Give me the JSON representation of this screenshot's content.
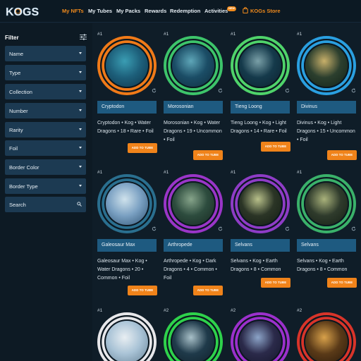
{
  "brand": {
    "logo_text": "KOGS"
  },
  "nav": {
    "my_nfts": "My NFTs",
    "my_tubes": "My Tubes",
    "my_packs": "My Packs",
    "rewards": "Rewards",
    "redemption": "Redemption",
    "activities": "Activities",
    "activities_badge": "NEW",
    "store": "KOGs Store"
  },
  "sidebar": {
    "title": "Filter",
    "filters": [
      {
        "label": "Name"
      },
      {
        "label": "Type"
      },
      {
        "label": "Collection"
      },
      {
        "label": "Number"
      },
      {
        "label": "Rarity"
      },
      {
        "label": "Foil"
      },
      {
        "label": "Border Color"
      },
      {
        "label": "Border Type"
      }
    ],
    "search_placeholder": "Search"
  },
  "cards": [
    {
      "number": "#1",
      "name": "Cryptodon",
      "desc": "Cryptodon • Kog • Water Dragons • 18 • Rare • Foil",
      "button": "ADD TO TUBE",
      "ring": "#f07a18"
    },
    {
      "number": "#1",
      "name": "Morosonian",
      "desc": "Morosonian • Kog • Water Dragons • 19 • Uncommon • Foil",
      "button": "ADD TO TUBE",
      "ring": "#3dc46a"
    },
    {
      "number": "#1",
      "name": "Tieng Loong",
      "desc": "Tieng Loong • Kog • Light Dragons • 14 • Rare • Foil",
      "button": "ADD TO TUBE",
      "ring": "#4fd36a"
    },
    {
      "number": "#1",
      "name": "Divinus",
      "desc": "Divinus • Kog • Light Dragons • 15 • Uncommon • Foil",
      "button": "ADD TO TUBE",
      "ring": "#2a9fe0"
    },
    {
      "number": "#1",
      "name": "Galeosaur Max",
      "desc": "Galeosaur Max • Kog • Water Dragons • 20 • Common • Foil",
      "button": "ADD TO TUBE",
      "ring": "#2a6f8f"
    },
    {
      "number": "#1",
      "name": "Arthropede",
      "desc": "Arthropede • Kog • Dark Dragons • 4 • Common • Foil",
      "button": "ADD TO TUBE",
      "ring": "#9a35c8"
    },
    {
      "number": "#1",
      "name": "Selvans",
      "desc": "Selvans • Kog • Earth Dragons • 8 • Common",
      "button": "ADD TO TUBE",
      "ring": "#8e3cc6"
    },
    {
      "number": "#1",
      "name": "Selvans",
      "desc": "Selvans • Kog • Earth Dragons • 8 • Common",
      "button": "ADD TO TUBE",
      "ring": "#3ab16a"
    },
    {
      "number": "#1",
      "name": "",
      "desc": "",
      "button": "",
      "ring": "#e7e7ea"
    },
    {
      "number": "#2",
      "name": "",
      "desc": "",
      "button": "",
      "ring": "#2ed24b"
    },
    {
      "number": "#2",
      "name": "",
      "desc": "",
      "button": "",
      "ring": "#9b30cc"
    },
    {
      "number": "#2",
      "name": "",
      "desc": "",
      "button": "",
      "ring": "#d8342a"
    }
  ],
  "icons": {
    "filter": "sliders-icon",
    "caret": "chevron-down-icon",
    "search": "search-icon",
    "refresh": "refresh-icon",
    "store": "bag-icon"
  },
  "colors": {
    "accent": "#f08a1c",
    "panel": "#1c3a52",
    "namebar": "#1e5a80",
    "background": "#0f1d28"
  }
}
